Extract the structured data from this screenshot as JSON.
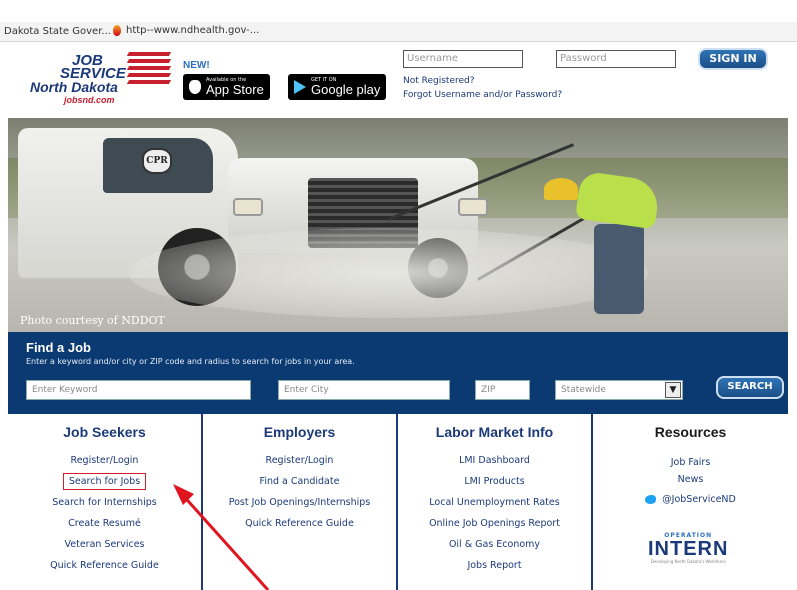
{
  "browser": {
    "tab1_title": "Dakota State Gover...",
    "tab2_title": "http--www.ndhealth.gov-..."
  },
  "logo": {
    "line1": "JOB",
    "line2": "SERVICE",
    "line3": "North Dakota",
    "line4": "jobsnd.com"
  },
  "apps": {
    "new_label": "NEW!",
    "appstore_small": "Available on the",
    "appstore_big": "App Store",
    "gplay_small": "GET IT ON",
    "gplay_big": "Google play"
  },
  "login": {
    "username_placeholder": "Username",
    "password_placeholder": "Password",
    "signin_label": "SIGN IN",
    "not_registered": "Not Registered?",
    "forgot": "Forgot Username and/or Password?"
  },
  "hero": {
    "emblem": "CPR",
    "credit": "Photo courtesy of NDDOT"
  },
  "find_job": {
    "title": "Find a Job",
    "subtitle": "Enter a keyword and/or city or ZIP code and radius to search for jobs in your area.",
    "keyword_placeholder": "Enter Keyword",
    "city_placeholder": "Enter City",
    "zip_placeholder": "ZIP",
    "radius_value": "Statewide",
    "search_label": "SEARCH"
  },
  "columns": {
    "job_seekers": {
      "title": "Job Seekers",
      "items": [
        "Register/Login",
        "Search for Jobs",
        "Search for Internships",
        "Create Resumé",
        "Veteran Services",
        "Quick Reference Guide"
      ]
    },
    "employers": {
      "title": "Employers",
      "items": [
        "Register/Login",
        "Find a Candidate",
        "Post Job Openings/Internships",
        "Quick Reference Guide"
      ]
    },
    "lmi": {
      "title": "Labor Market Info",
      "items": [
        "LMI Dashboard",
        "LMI Products",
        "Local Unemployment Rates",
        "Online Job Openings Report",
        "Oil & Gas Economy",
        "Jobs Report"
      ]
    },
    "resources": {
      "title": "Resources",
      "items": [
        "Job Fairs",
        "News"
      ],
      "twitter": "@JobServiceND",
      "intern_op": "OPERATION",
      "intern_big": "INTERN",
      "intern_tag": "Developing North Dakota's Workforce"
    }
  },
  "colors": {
    "brand_navy": "#1c3a7a",
    "band_blue": "#0b3a72",
    "accent_red": "#d31f2a"
  }
}
